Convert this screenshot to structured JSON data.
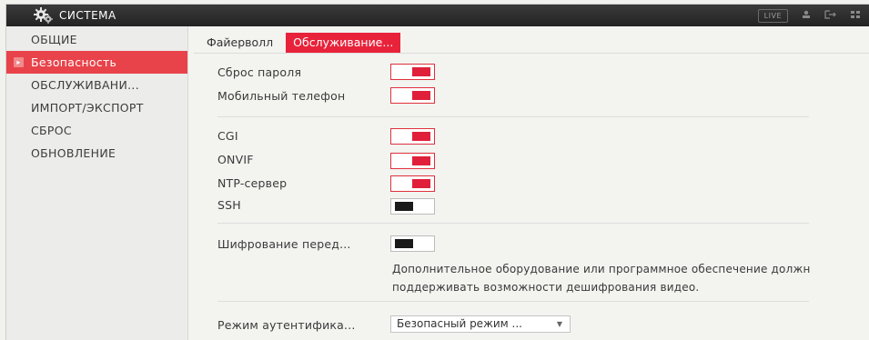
{
  "titlebar": {
    "title": "СИСТЕМА",
    "live_label": "LIVE",
    "icons": [
      "gear-icon",
      "user-icon",
      "logout-icon",
      "grid-icon"
    ]
  },
  "sidebar": {
    "items": [
      {
        "label": "ОБЩИЕ",
        "active": false
      },
      {
        "label": "Безопасность",
        "active": true
      },
      {
        "label": "ОБСЛУЖИВАНИ...",
        "active": false
      },
      {
        "label": "ИМПОРТ/ЭКСПОРТ",
        "active": false
      },
      {
        "label": "СБРОС",
        "active": false
      },
      {
        "label": "ОБНОВЛЕНИЕ",
        "active": false
      }
    ]
  },
  "tabs": [
    {
      "label": "Файерволл",
      "active": false
    },
    {
      "label": "Обслуживание...",
      "active": true
    }
  ],
  "settings": {
    "password_reset": {
      "label": "Сброс пароля",
      "enabled": true
    },
    "mobile_phone": {
      "label": "Мобильный телефон",
      "enabled": true
    },
    "cgi": {
      "label": "CGI",
      "enabled": true
    },
    "onvif": {
      "label": "ONVIF",
      "enabled": true
    },
    "ntp": {
      "label": "NTP-сервер",
      "enabled": true
    },
    "ssh": {
      "label": "SSH",
      "enabled": false
    },
    "encryption": {
      "label": "Шифрование перед...",
      "enabled": false
    },
    "encryption_note_line1": "Дополнительное оборудование или программное обеспечение должн",
    "encryption_note_line2": "поддерживать возможности дешифрования видео.",
    "auth_mode": {
      "label": "Режим аутентифика...",
      "value": "Безопасный режим ..."
    }
  },
  "colors": {
    "accent": "#e8434a",
    "toggle_on": "#e0203a",
    "toggle_off": "#1a1a1a",
    "titlebar": "#2a2a2a"
  }
}
